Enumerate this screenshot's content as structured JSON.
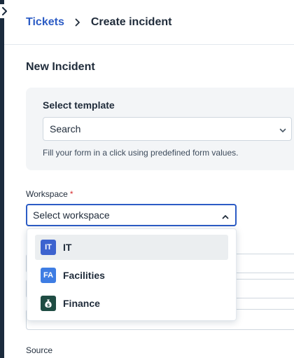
{
  "breadcrumb": {
    "parent": "Tickets",
    "current": "Create incident"
  },
  "page": {
    "title": "New Incident"
  },
  "template": {
    "label": "Select template",
    "value": "Search",
    "help": "Fill your form in a click using predefined form values."
  },
  "workspace": {
    "label": "Workspace",
    "required_mark": "*",
    "placeholder": "Select workspace",
    "options": [
      {
        "badge": "IT",
        "label": "IT",
        "color": "#3d63cf",
        "highlighted": true
      },
      {
        "badge": "FA",
        "label": "Facilities",
        "color": "#3e7de3",
        "highlighted": false
      },
      {
        "badge": "",
        "label": "Finance",
        "color": "#1f4c43",
        "icon": "money-bag-icon",
        "highlighted": false
      }
    ]
  },
  "source": {
    "label": "Source"
  },
  "colors": {
    "accent": "#2c5cc5",
    "rail": "#1b2b3d",
    "required": "#d72d30"
  }
}
